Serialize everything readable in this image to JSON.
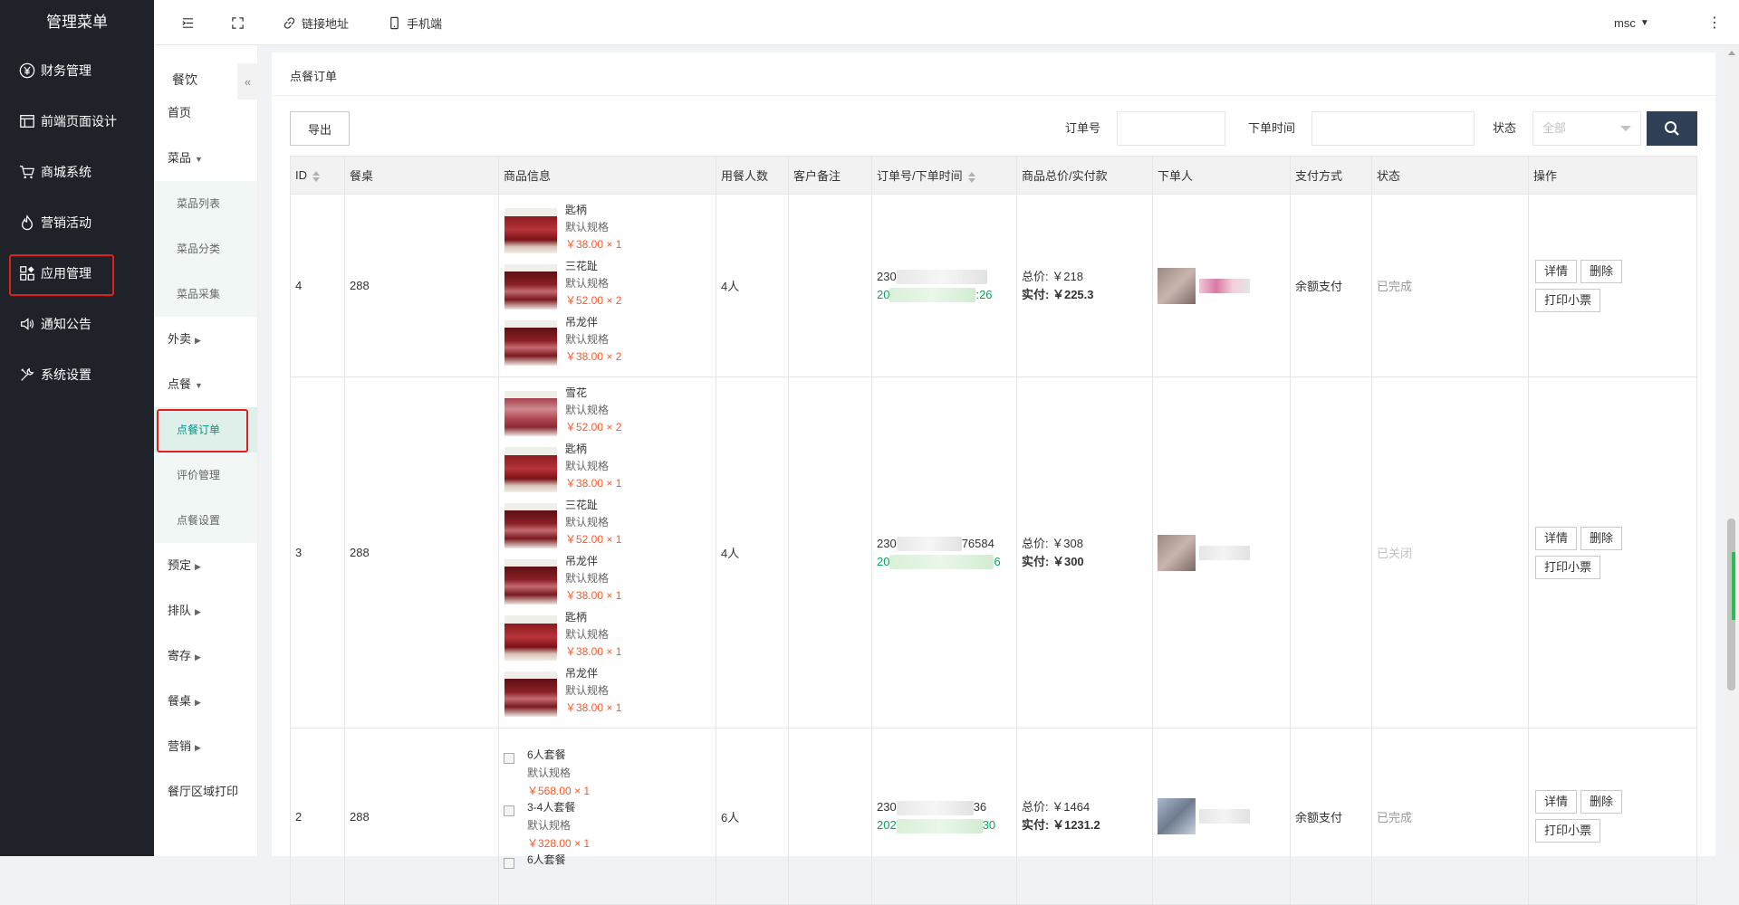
{
  "sidebar": {
    "title": "管理菜单",
    "items": [
      {
        "label": "财务管理",
        "icon": "yen-icon"
      },
      {
        "label": "前端页面设计",
        "icon": "layout-icon"
      },
      {
        "label": "商城系统",
        "icon": "cart-icon"
      },
      {
        "label": "营销活动",
        "icon": "fire-icon"
      },
      {
        "label": "应用管理",
        "icon": "apps-icon"
      },
      {
        "label": "通知公告",
        "icon": "speaker-icon"
      },
      {
        "label": "系统设置",
        "icon": "tools-icon"
      }
    ]
  },
  "subnav": {
    "title": "餐饮",
    "collapse": "«",
    "home": "首页",
    "dishes": "菜品",
    "dish_list": "菜品列表",
    "dish_category": "菜品分类",
    "dish_collect": "菜品采集",
    "takeout": "外卖",
    "order": "点餐",
    "order_list": "点餐订单",
    "review": "评价管理",
    "order_settings": "点餐设置",
    "reserve": "预定",
    "queue": "排队",
    "storage": "寄存",
    "tables": "餐桌",
    "marketing": "营销",
    "print": "餐厅区域打印"
  },
  "topbar": {
    "link": "链接地址",
    "mobile": "手机端",
    "user": "msc"
  },
  "page": {
    "title": "点餐订单",
    "export": "导出",
    "order_no_label": "订单号",
    "order_time_label": "下单时间",
    "status_label": "状态",
    "status_value": "全部"
  },
  "table": {
    "headers": [
      "ID",
      "餐桌",
      "商品信息",
      "用餐人数",
      "客户备注",
      "订单号/下单时间",
      "商品总价/实付款",
      "下单人",
      "支付方式",
      "状态",
      "操作"
    ],
    "total_label": "总价:",
    "paid_label": "实付:",
    "btn_detail": "详情",
    "btn_delete": "删除",
    "btn_print": "打印小票",
    "rows": [
      {
        "id": "4",
        "table": "288",
        "people": "4人",
        "remark": "",
        "order_prefix": "230",
        "order_suffix": "",
        "time_prefix": "20",
        "time_suffix": ":26",
        "total": "￥218",
        "paid": "￥225.3",
        "pay": "余额支付",
        "status": "已完成",
        "goods": [
          {
            "name": "匙柄",
            "spec": "默认规格",
            "price": "￥38.00 × 1"
          },
          {
            "name": "三花趾",
            "spec": "默认规格",
            "price": "￥52.00 × 2"
          },
          {
            "name": "吊龙伴",
            "spec": "默认规格",
            "price": "￥38.00 × 2"
          }
        ]
      },
      {
        "id": "3",
        "table": "288",
        "people": "4人",
        "remark": "",
        "order_prefix": "230",
        "order_suffix": "76584",
        "time_prefix": "20",
        "time_suffix": "6",
        "total": "￥308",
        "paid": "￥300",
        "pay": "",
        "status": "已关闭",
        "goods": [
          {
            "name": "雪花",
            "spec": "默认规格",
            "price": "￥52.00 × 2"
          },
          {
            "name": "匙柄",
            "spec": "默认规格",
            "price": "￥38.00 × 1"
          },
          {
            "name": "三花趾",
            "spec": "默认规格",
            "price": "￥52.00 × 1"
          },
          {
            "name": "吊龙伴",
            "spec": "默认规格",
            "price": "￥38.00 × 1"
          },
          {
            "name": "匙柄",
            "spec": "默认规格",
            "price": "￥38.00 × 1"
          },
          {
            "name": "吊龙伴",
            "spec": "默认规格",
            "price": "￥38.00 × 1"
          }
        ]
      },
      {
        "id": "2",
        "table": "288",
        "people": "6人",
        "remark": "",
        "order_prefix": "230",
        "order_suffix": "36",
        "time_prefix": "202",
        "time_suffix": "30",
        "total": "￥1464",
        "paid": "￥1231.2",
        "pay": "余额支付",
        "status": "已完成",
        "goods": [
          {
            "name": "6人套餐",
            "spec": "默认规格",
            "price": "￥568.00 × 1"
          },
          {
            "name": "3-4人套餐",
            "spec": "默认规格",
            "price": "￥328.00 × 1"
          },
          {
            "name": "6人套餐",
            "spec": "",
            "price": ""
          }
        ]
      }
    ]
  }
}
